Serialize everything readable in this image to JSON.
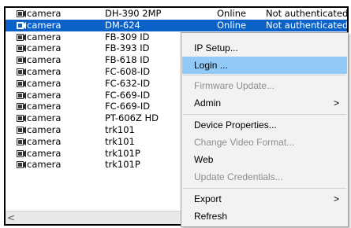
{
  "devices": [
    {
      "type": "camera",
      "model": "DH-390 2MP",
      "status": "Online",
      "auth": "Not authenticated"
    },
    {
      "type": "camera",
      "model": "DM-624",
      "status": "Online",
      "auth": "Not authenticated",
      "selected": true
    },
    {
      "type": "camera",
      "model": "FB-309 ID",
      "status": "",
      "auth": ""
    },
    {
      "type": "camera",
      "model": "FB-393 ID",
      "status": "",
      "auth": ""
    },
    {
      "type": "camera",
      "model": "FB-618 ID",
      "status": "",
      "auth": ""
    },
    {
      "type": "camera",
      "model": "FC-608-ID",
      "status": "",
      "auth": ""
    },
    {
      "type": "camera",
      "model": "FC-632-ID",
      "status": "",
      "auth": ""
    },
    {
      "type": "camera",
      "model": "FC-669-ID",
      "status": "",
      "auth": ""
    },
    {
      "type": "camera",
      "model": "FC-669-ID",
      "status": "",
      "auth": ""
    },
    {
      "type": "camera",
      "model": "PT-606Z HD",
      "status": "",
      "auth": ""
    },
    {
      "type": "camera",
      "model": "trk101",
      "status": "",
      "auth": ""
    },
    {
      "type": "camera",
      "model": "trk101",
      "status": "",
      "auth": ""
    },
    {
      "type": "camera",
      "model": "trk101P",
      "status": "",
      "auth": ""
    },
    {
      "type": "camera",
      "model": "trk101P",
      "status": "",
      "auth": ""
    }
  ],
  "context_menu": {
    "items": [
      {
        "label": "IP Setup...",
        "enabled": true
      },
      {
        "label": "Login ...",
        "enabled": true,
        "highlighted": true
      },
      {
        "label": "Firmware Update...",
        "enabled": false
      },
      {
        "label": "Admin",
        "enabled": true,
        "submenu": true
      },
      {
        "label": "Device Properties...",
        "enabled": true
      },
      {
        "label": "Change Video Format...",
        "enabled": false
      },
      {
        "label": "Web",
        "enabled": true
      },
      {
        "label": "Update Credentials...",
        "enabled": false
      },
      {
        "label": "Export",
        "enabled": true,
        "submenu": true
      },
      {
        "label": "Refresh",
        "enabled": true
      }
    ],
    "submenu_arrow": ">"
  },
  "scrollbar": {
    "left_arrow": "<"
  },
  "colors": {
    "selection": "#0a62c9",
    "menu_highlight": "#91c9f7",
    "menu_bg": "#f2f2f2"
  }
}
